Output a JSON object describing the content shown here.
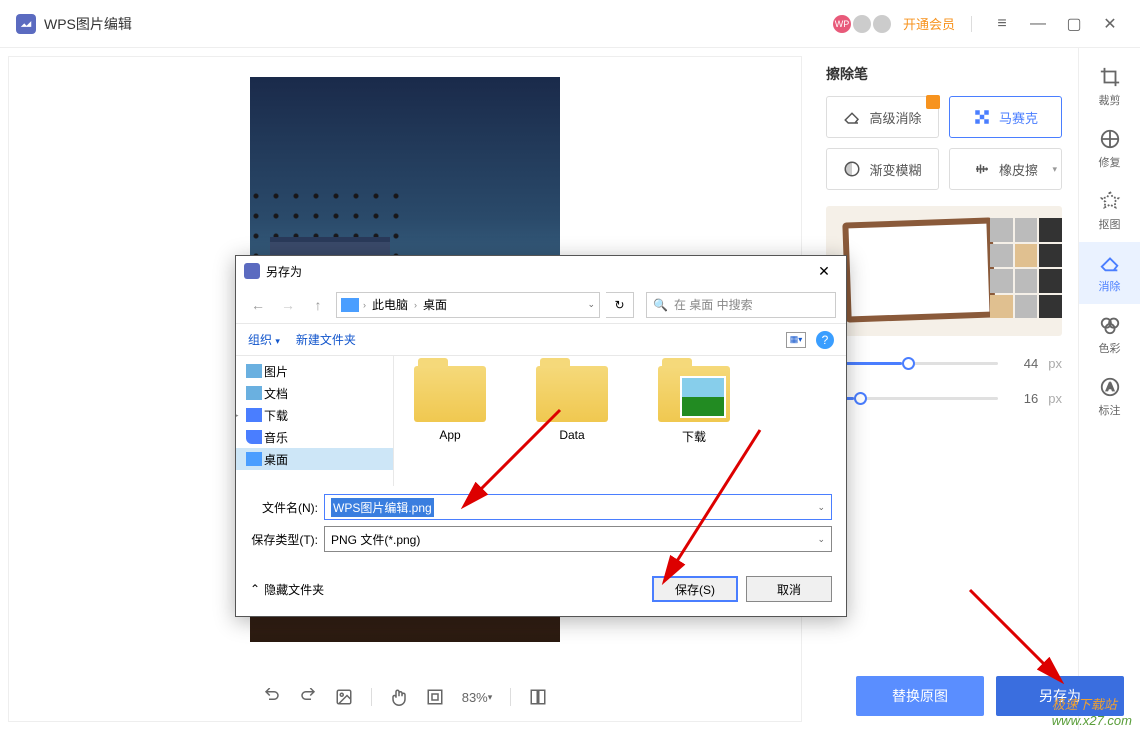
{
  "titlebar": {
    "title": "WPS图片编辑",
    "vip_link": "开通会员",
    "avatar_text": "WP"
  },
  "side_toolbar": [
    {
      "label": "裁剪",
      "key": "crop"
    },
    {
      "label": "修复",
      "key": "repair"
    },
    {
      "label": "抠图",
      "key": "cutout"
    },
    {
      "label": "消除",
      "key": "erase",
      "active": true
    },
    {
      "label": "色彩",
      "key": "color"
    },
    {
      "label": "标注",
      "key": "annotate"
    }
  ],
  "panel": {
    "title": "擦除笔",
    "tools": [
      {
        "label": "高级消除",
        "badge": true
      },
      {
        "label": "马赛克",
        "active": true
      },
      {
        "label": "渐变模糊"
      },
      {
        "label": "橡皮擦",
        "dropdown": true
      }
    ],
    "sliders": [
      {
        "value": "44",
        "unit": "px",
        "pct": 44
      },
      {
        "value": "16",
        "unit": "px",
        "pct": 16
      }
    ]
  },
  "canvas_toolbar": {
    "zoom": "83%"
  },
  "bottom": {
    "replace": "替换原图",
    "saveas": "另存为"
  },
  "dialog": {
    "title": "另存为",
    "path": {
      "root": "此电脑",
      "current": "桌面"
    },
    "search_placeholder": "在 桌面 中搜索",
    "organize": "组织",
    "new_folder": "新建文件夹",
    "tree": [
      {
        "label": "图片",
        "ico": "ico-pic"
      },
      {
        "label": "文档",
        "ico": "ico-doc"
      },
      {
        "label": "下载",
        "ico": "ico-down",
        "expandable": true
      },
      {
        "label": "音乐",
        "ico": "ico-music"
      },
      {
        "label": "桌面",
        "ico": "ico-desk",
        "selected": true
      }
    ],
    "files": [
      {
        "name": "App",
        "type": "folder"
      },
      {
        "name": "Data",
        "type": "folder"
      },
      {
        "name": "下载",
        "type": "folder-img"
      }
    ],
    "filename_label": "文件名(N):",
    "filename_value": "WPS图片编辑.png",
    "filetype_label": "保存类型(T):",
    "filetype_value": "PNG 文件(*.png)",
    "hide_folders": "隐藏文件夹",
    "save_btn": "保存(S)",
    "cancel_btn": "取消"
  },
  "watermark": {
    "cn": "极速下载站",
    "url": "www.x27.com"
  }
}
